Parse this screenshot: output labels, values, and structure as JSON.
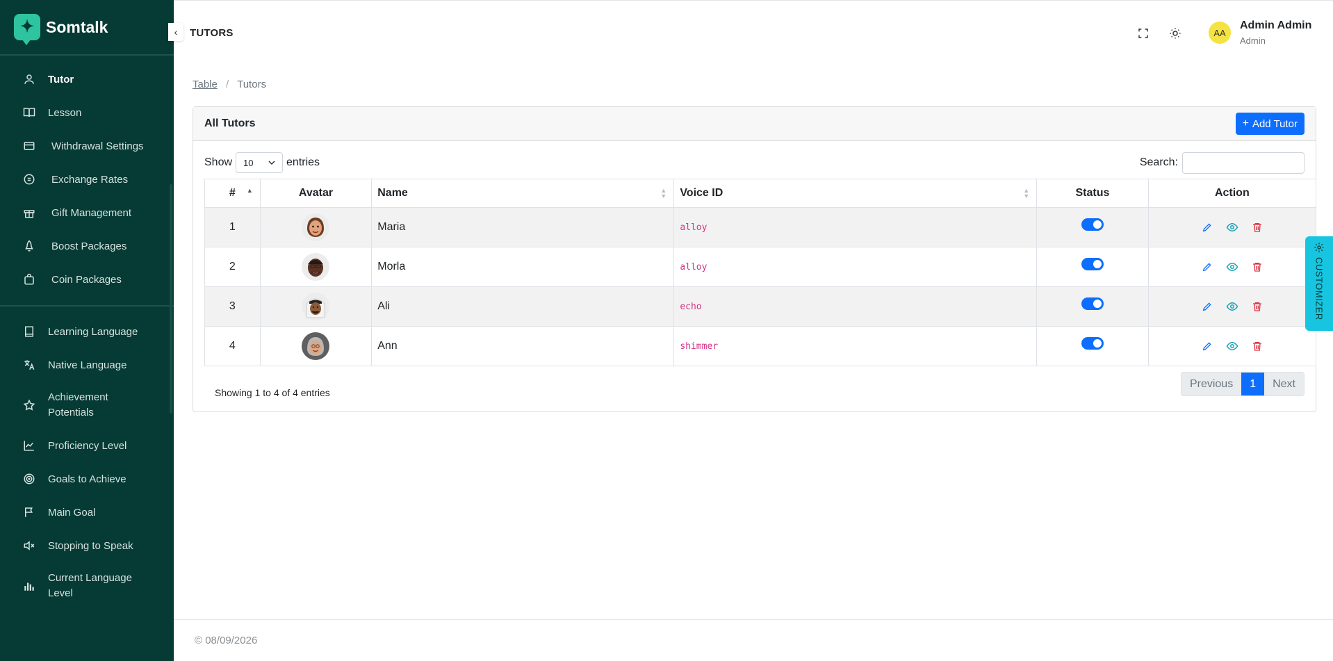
{
  "brand": {
    "name": "Somtalk"
  },
  "sidebar": {
    "group1": [
      {
        "label": "Tutor",
        "icon": "user-icon"
      },
      {
        "label": "Lesson",
        "icon": "book-open-icon"
      },
      {
        "label": "Withdrawal Settings",
        "icon": "wallet-icon"
      },
      {
        "label": "Exchange Rates",
        "icon": "coin-icon"
      },
      {
        "label": "Gift Management",
        "icon": "gift-icon"
      },
      {
        "label": "Boost Packages",
        "icon": "rocket-icon"
      },
      {
        "label": "Coin Packages",
        "icon": "bag-icon"
      }
    ],
    "group2": [
      {
        "label": "Learning Language",
        "icon": "book-icon"
      },
      {
        "label": "Native Language",
        "icon": "translate-icon"
      },
      {
        "label": "Achievement Potentials",
        "icon": "star-icon"
      },
      {
        "label": "Proficiency Level",
        "icon": "chart-line-icon"
      },
      {
        "label": "Goals to Achieve",
        "icon": "target-icon"
      },
      {
        "label": "Main Goal",
        "icon": "flag-icon"
      },
      {
        "label": "Stopping to Speak",
        "icon": "mute-icon"
      },
      {
        "label": "Current Language Level",
        "icon": "bars-icon"
      }
    ]
  },
  "header": {
    "title": "TUTORS",
    "user_initials": "AA",
    "user_name": "Admin Admin",
    "user_role": "Admin"
  },
  "breadcrumb": {
    "parent": "Table",
    "current": "Tutors"
  },
  "card": {
    "title": "All Tutors",
    "add_button": "Add Tutor",
    "show_label": "Show",
    "entries_label": "entries",
    "page_size": "10",
    "search_label": "Search:"
  },
  "table": {
    "columns": [
      "#",
      "Avatar",
      "Name",
      "Voice ID",
      "Status",
      "Action"
    ],
    "rows": [
      {
        "num": "1",
        "name": "Maria",
        "voice": "alloy",
        "status_on": true,
        "avatar": "woman-avatar"
      },
      {
        "num": "2",
        "name": "Morla",
        "voice": "alloy",
        "status_on": true,
        "avatar": "man-avatar"
      },
      {
        "num": "3",
        "name": "Ali",
        "voice": "echo",
        "status_on": true,
        "avatar": "man-keffiyeh-avatar"
      },
      {
        "num": "4",
        "name": "Ann",
        "voice": "shimmer",
        "status_on": true,
        "avatar": "elderly-woman-avatar"
      }
    ]
  },
  "pagination": {
    "info": "Showing 1 to 4 of 4 entries",
    "previous": "Previous",
    "current": "1",
    "next": "Next"
  },
  "customizer": {
    "label": "CUSTOMIZER"
  },
  "footer": {
    "text": "© 08/09/2026"
  },
  "colors": {
    "sidebar_bg": "#063a34",
    "accent": "#0d6efd",
    "voice_text": "#d63384",
    "delete_icon": "#dc3545",
    "view_icon": "#17a2b8",
    "customizer": "#17c5e0"
  }
}
